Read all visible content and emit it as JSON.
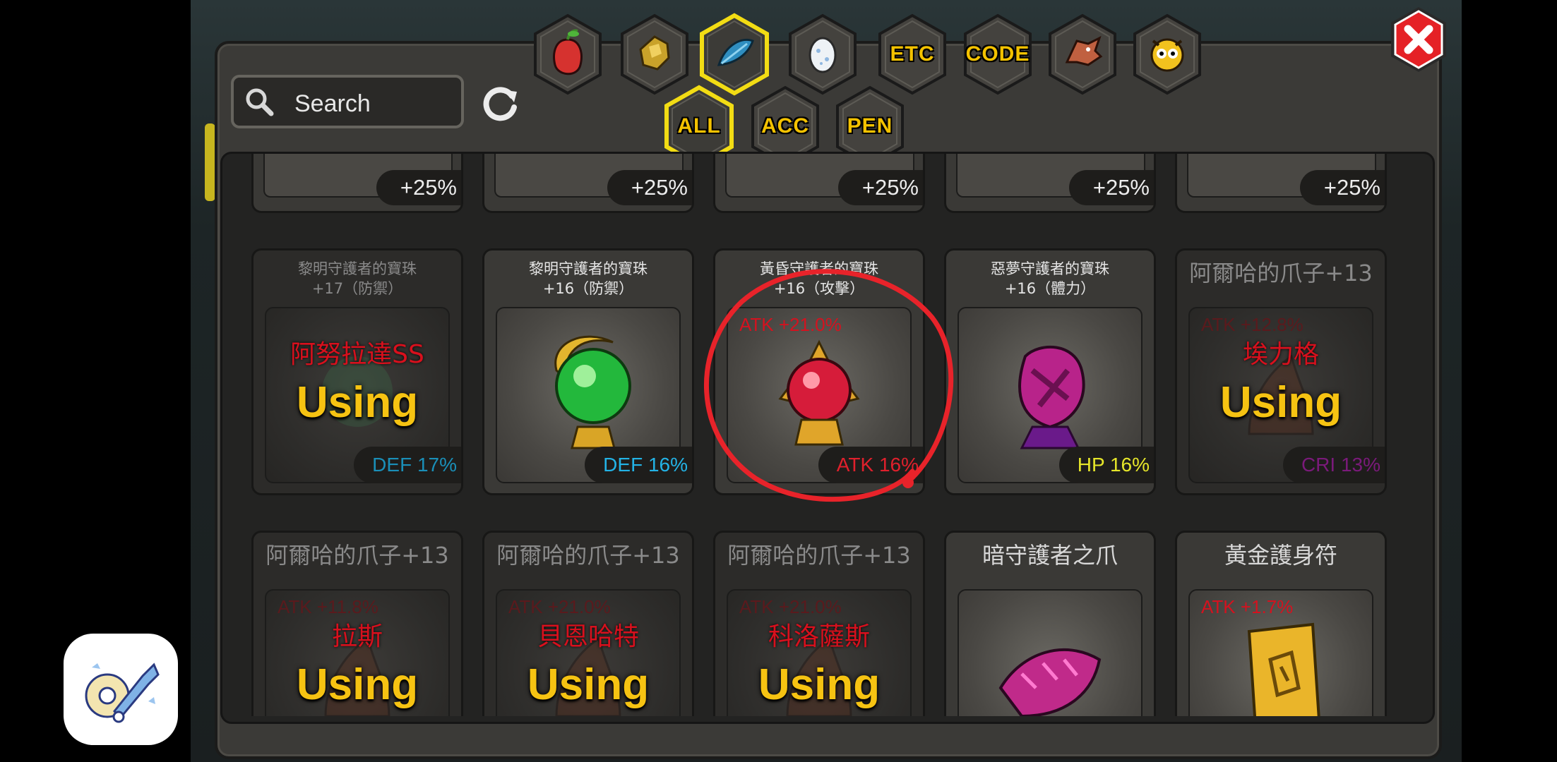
{
  "search": {
    "placeholder": "Search"
  },
  "tabs_top": [
    {
      "icon": "fruit-icon"
    },
    {
      "icon": "gold-ore-icon"
    },
    {
      "icon": "feather-icon",
      "selected": true
    },
    {
      "icon": "egg-icon"
    },
    {
      "label": "ETC"
    },
    {
      "label": "CODE"
    },
    {
      "icon": "dragon-icon"
    },
    {
      "icon": "owl-icon"
    }
  ],
  "tabs_filter": [
    {
      "label": "ALL",
      "selected": true
    },
    {
      "label": "ACC"
    },
    {
      "label": "PEN"
    }
  ],
  "top_row": [
    "+25%",
    "+25%",
    "+25%",
    "+25%",
    "+25%"
  ],
  "row2": [
    {
      "name": "黎明守護者的寶珠\n+17（防禦）",
      "owner": "阿努拉達SS",
      "using": "Using",
      "stat": "DEF 17%",
      "stat_color": "#1a8fb8",
      "dim": true
    },
    {
      "name": "黎明守護者的寶珠\n+16（防禦）",
      "stat": "DEF 16%",
      "stat_color": "#23b3e6"
    },
    {
      "name": "黃昏守護者的寶珠\n+16（攻擊）",
      "atk": "ATK +21.0%",
      "stat": "ATK 16%",
      "stat_color": "#e0202c",
      "circled": true
    },
    {
      "name": "惡夢守護者的寶珠\n+16（體力）",
      "stat": "HP 16%",
      "stat_color": "#e6e62a"
    },
    {
      "name": "阿爾哈的爪子+13",
      "atk": "ATK +12.8%",
      "owner": "埃力格",
      "using": "Using",
      "stat": "CRI 13%",
      "stat_color": "#7a1a7a",
      "dim": true
    }
  ],
  "row3": [
    {
      "name": "阿爾哈的爪子+13",
      "atk": "ATK +11.8%",
      "owner": "拉斯",
      "using": "Using",
      "dim": true
    },
    {
      "name": "阿爾哈的爪子+13",
      "atk": "ATK +21.0%",
      "owner": "貝恩哈特",
      "using": "Using",
      "dim": true
    },
    {
      "name": "阿爾哈的爪子+13",
      "atk": "ATK +21.0%",
      "owner": "科洛薩斯",
      "using": "Using",
      "dim": true
    },
    {
      "name": "暗守護者之爪"
    },
    {
      "name": "黃金護身符",
      "atk": "ATK +1.7%"
    }
  ]
}
